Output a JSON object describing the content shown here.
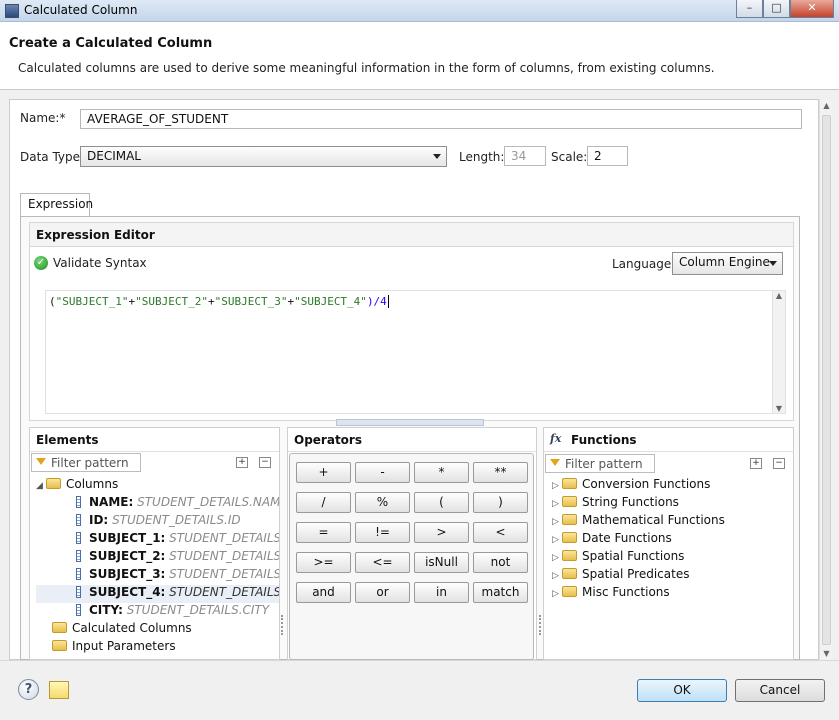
{
  "window": {
    "title": "Calculated Column",
    "controls": [
      "–",
      "□",
      "✕"
    ]
  },
  "header": {
    "title": "Create a Calculated Column",
    "description": "Calculated columns are used to derive some meaningful information in the form of columns, from existing columns."
  },
  "form": {
    "name_label": "Name:*",
    "name_value": "AVERAGE_OF_STUDENT",
    "datatype_label": "Data Type:",
    "datatype_value": "DECIMAL",
    "length_label": "Length:",
    "length_value": "34",
    "scale_label": "Scale:",
    "scale_value": "2"
  },
  "tabs": [
    "Expression"
  ],
  "expression_editor": {
    "title": "Expression Editor",
    "validate_label": "Validate Syntax",
    "language_label": "Language:",
    "language_value": "Column Engine",
    "expr": {
      "p1": "(",
      "s1": "\"SUBJECT_1\"",
      "o1": "+",
      "s2": "\"SUBJECT_2\"",
      "o2": "+",
      "s3": "\"SUBJECT_3\"",
      "o3": "+",
      "s4": "\"SUBJECT_4\"",
      "tail": ")/4"
    }
  },
  "elements": {
    "title": "Elements",
    "filter_placeholder": "Filter pattern",
    "columns_label": "Columns",
    "columns": [
      {
        "name": "NAME:",
        "source": "STUDENT_DETAILS.NAME"
      },
      {
        "name": "ID:",
        "source": "STUDENT_DETAILS.ID"
      },
      {
        "name": "SUBJECT_1:",
        "source": "STUDENT_DETAILS.SUB"
      },
      {
        "name": "SUBJECT_2:",
        "source": "STUDENT_DETAILS.SUB"
      },
      {
        "name": "SUBJECT_3:",
        "source": "STUDENT_DETAILS.SUB"
      },
      {
        "name": "SUBJECT_4:",
        "source": "STUDENT_DETAILS.SUB"
      },
      {
        "name": "CITY:",
        "source": "STUDENT_DETAILS.CITY"
      }
    ],
    "calculated_columns_label": "Calculated Columns",
    "input_parameters_label": "Input Parameters"
  },
  "operators": {
    "title": "Operators",
    "rows": [
      [
        "+",
        "-",
        "*",
        "**"
      ],
      [
        "/",
        "%",
        "(",
        ")"
      ],
      [
        "=",
        "!=",
        ">",
        "<"
      ],
      [
        ">=",
        "<=",
        "isNull",
        "not"
      ],
      [
        "and",
        "or",
        "in",
        "match"
      ]
    ]
  },
  "functions": {
    "title": "Functions",
    "fx_symbol": "fx",
    "filter_placeholder": "Filter pattern",
    "items": [
      "Conversion Functions",
      "String Functions",
      "Mathematical Functions",
      "Date Functions",
      "Spatial Functions",
      "Spatial Predicates",
      "Misc Functions"
    ]
  },
  "footer": {
    "help_symbol": "?",
    "ok_label": "OK",
    "cancel_label": "Cancel"
  },
  "colors": {
    "link_blue": "#2a00ff",
    "string_green": "#2a7a2a",
    "folder": "#e7bf4d",
    "ok_border": "#3c7fb1"
  }
}
